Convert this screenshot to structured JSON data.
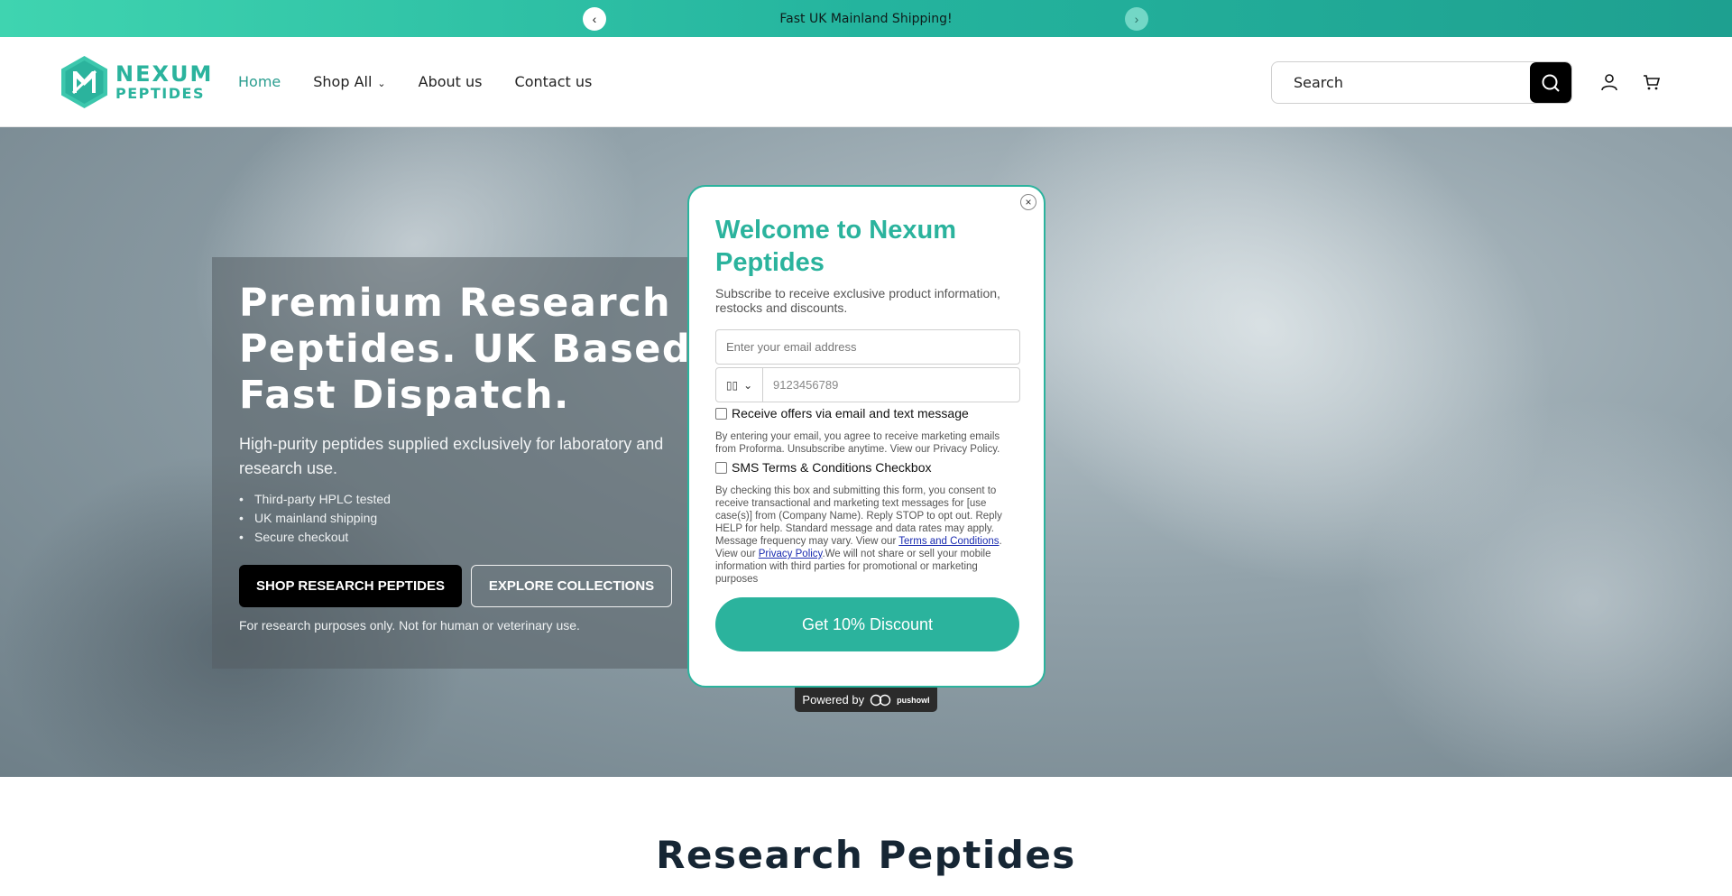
{
  "announcement": {
    "text": "Fast UK Mainland Shipping!",
    "prev_icon": "chevron-left-icon",
    "next_icon": "chevron-right-icon"
  },
  "header": {
    "logo_line1": "NEXUM",
    "logo_line2": "PEPTIDES",
    "nav": [
      {
        "label": "Home",
        "active": true
      },
      {
        "label": "Shop All",
        "has_dropdown": true
      },
      {
        "label": "About us"
      },
      {
        "label": "Contact us"
      }
    ],
    "search_placeholder": "Search",
    "icons": [
      "search-icon",
      "account-icon",
      "cart-icon"
    ]
  },
  "hero": {
    "title": "Premium Research Peptides. UK Based. Fast Dispatch.",
    "subtitle_line1": "High-purity peptides supplied exclusively for laboratory and",
    "subtitle_line2": "research use.",
    "bullets": [
      "Third-party HPLC tested",
      "UK mainland shipping",
      "Secure checkout"
    ],
    "primary_button": "SHOP RESEARCH PEPTIDES",
    "secondary_button": "EXPLORE COLLECTIONS",
    "disclaimer": "For research purposes only. Not for human or veterinary use."
  },
  "section_title": "Research Peptides",
  "popup": {
    "title": "Welcome to Nexum Peptides",
    "subtitle": "Subscribe to receive exclusive product information, restocks and discounts.",
    "email_placeholder": "Enter your email address",
    "phone_placeholder": "9123456789",
    "offers_checkbox_label": "Receive offers via email and text message",
    "email_legal": "By entering your email, you agree to receive marketing emails from Proforma. Unsubscribe anytime. View our Privacy Policy.",
    "sms_checkbox_label": "SMS Terms & Conditions Checkbox",
    "sms_legal_part1": "By checking this box and submitting this form, you consent to receive transactional and marketing text messages for [use case(s)] from (Company Name). Reply STOP to opt out. Reply HELP for help. Standard message and data rates may apply. Message frequency may vary. View our ",
    "sms_terms_link": "Terms and Conditions",
    "sms_legal_part2": ". View our ",
    "sms_privacy_link": "Privacy Policy",
    "sms_legal_part3": ".We will not share or sell your mobile information with third parties for promotional or marketing purposes",
    "submit_button": "Get 10% Discount",
    "close_label": "×",
    "powered_by": "Powered by",
    "powered_brand": "pushowl"
  },
  "colors": {
    "brand_teal": "#2bb39d",
    "nav_active": "#2a9d8f",
    "heading_dark": "#162634"
  }
}
